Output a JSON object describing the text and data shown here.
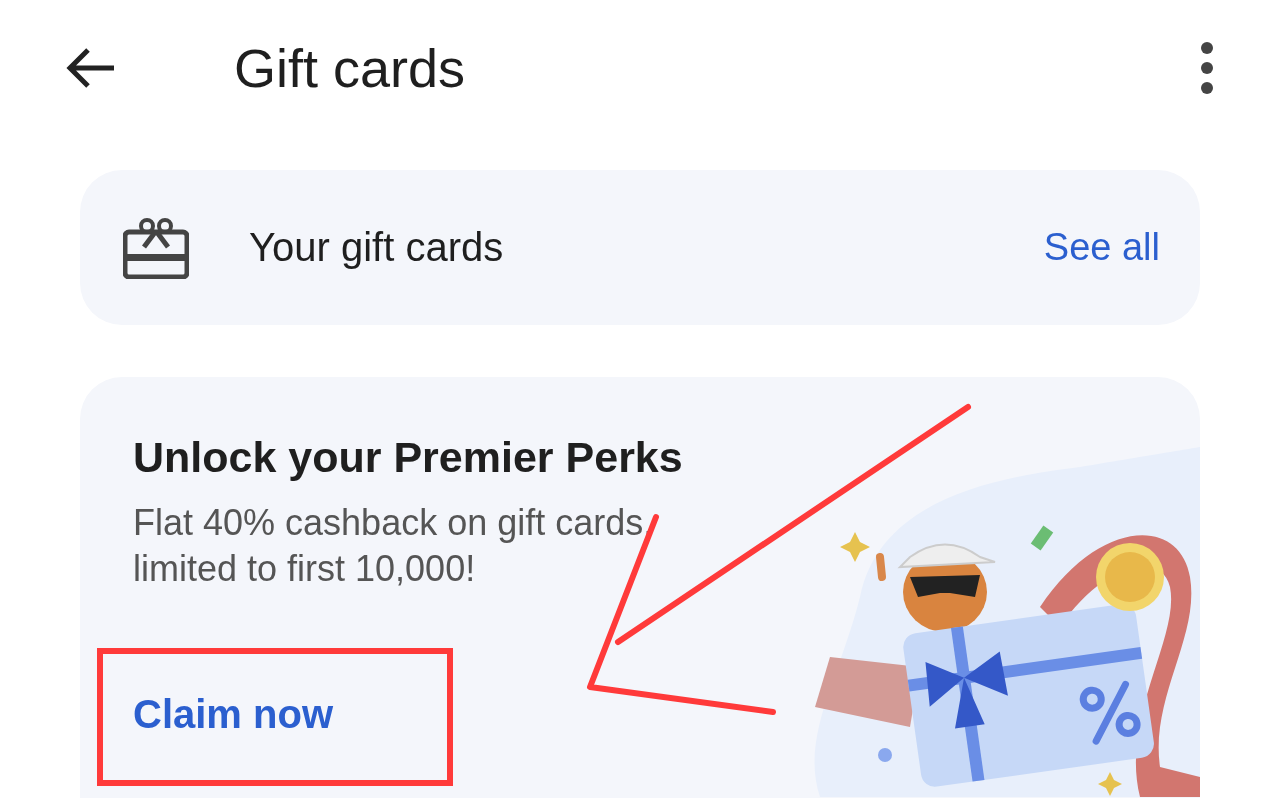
{
  "app_bar": {
    "title": "Gift cards"
  },
  "gift_cards_row": {
    "label": "Your gift cards",
    "action": "See all"
  },
  "promo_card": {
    "title": "Unlock your Premier Perks",
    "description": "Flat 40% cashback on gift cards, limited to first 10,000!",
    "action": "Claim now"
  }
}
